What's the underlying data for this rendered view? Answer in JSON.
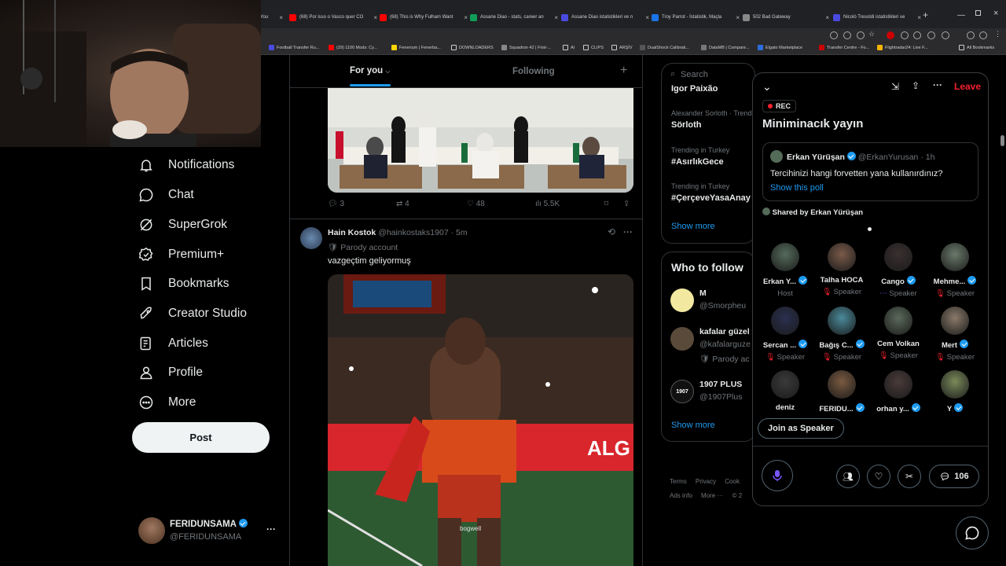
{
  "browser": {
    "tabs": [
      {
        "label": "You",
        "color": "#ff0000"
      },
      {
        "label": "(68) Por isso o Vasco quer CO",
        "color": "#ff0000"
      },
      {
        "label": "(68) This is Why Fulham Want",
        "color": "#ff0000"
      },
      {
        "label": "Assane Diao - stats, career an",
        "color": "#0f9d58"
      },
      {
        "label": "Assane Diao istatistikleri ve n",
        "color": "#4a4adf"
      },
      {
        "label": "Troy Parrot - İstatistik, Maçla",
        "color": "#1a73e8"
      },
      {
        "label": "502 Bad Gateway",
        "color": "#888888"
      },
      {
        "label": "Nicolò Tresoldi istatistikleri ve",
        "color": "#4a4adf"
      }
    ],
    "new_tab": "+",
    "bookmarks": [
      "Football Transfer Ru...",
      "(29) 1100 Mods: Cy...",
      "Fenerium | Fenerba...",
      "DOWNLOADERS",
      "Squadron 42 | First-...",
      "AI",
      "CLIPS",
      "ARŞİV",
      "DualShock Calibrati...",
      "DataMB | Compare...",
      "Elgato Marketplace",
      "Transfer Centre - Fo...",
      "Flightradar24: Live F...",
      "All Bookmarks"
    ]
  },
  "nav": {
    "items": [
      {
        "label": "Notifications",
        "icon": "bell-icon"
      },
      {
        "label": "Chat",
        "icon": "chat-icon"
      },
      {
        "label": "SuperGrok",
        "icon": "grok-icon"
      },
      {
        "label": "Premium+",
        "icon": "premium-icon"
      },
      {
        "label": "Bookmarks",
        "icon": "bookmark-icon"
      },
      {
        "label": "Creator Studio",
        "icon": "rocket-icon"
      },
      {
        "label": "Articles",
        "icon": "article-icon"
      },
      {
        "label": "Profile",
        "icon": "profile-icon"
      },
      {
        "label": "More",
        "icon": "more-icon"
      }
    ],
    "post_label": "Post",
    "account": {
      "name": "FERIDUNSAMA",
      "handle": "@FERIDUNSAMA",
      "more": "···"
    }
  },
  "timeline": {
    "tabs": [
      {
        "label": "For you"
      },
      {
        "label": "Following"
      }
    ],
    "add": "+",
    "tweet1": {
      "replies": "3",
      "retweets": "4",
      "likes": "48",
      "views": "5.5K"
    },
    "tweet2": {
      "name": "Hain Kostok",
      "handle": "@hainkostaks1907",
      "time": "· 5m",
      "badge": "Parody account",
      "text": "vazgeçtim geliyormuş",
      "watermark": "bogwell"
    }
  },
  "right": {
    "search_placeholder": "Search",
    "trends": [
      {
        "meta": "Alexander Sorloth · Trending",
        "title": "Sörloth"
      },
      {
        "meta": "Trending in Turkey",
        "title": "#AsırlıkGece"
      },
      {
        "meta": "Trending in Turkey",
        "title": "#ÇerçeveYasaAnay"
      }
    ],
    "top_trend_partial": "Igor Paixão",
    "show_more": "Show more",
    "who_to_follow": "Who to follow",
    "follow": [
      {
        "name": "M",
        "handle": "@Smorpheu",
        "extra": ""
      },
      {
        "name": "kafalar güzel",
        "handle": "@kafalarguze",
        "extra": "Parody ac"
      },
      {
        "name": "1907 PLUS",
        "handle": "@1907Plus",
        "extra": ""
      }
    ],
    "show_more2": "Show more",
    "footer": [
      "Terms",
      "Privacy",
      "Cook",
      "Ads info",
      "More ···",
      "© 2"
    ]
  },
  "space": {
    "leave": "Leave",
    "rec": "REC",
    "title": "Miniminacık yayın",
    "poll": {
      "author": "Erkan Yürüşan",
      "handle": "@ErkanYurusan",
      "time": "· 1h",
      "text": "Tercihinizi hangi forvetten yana kullanırdınız?",
      "link": "Show this poll"
    },
    "shared_by": "Shared by Erkan Yürüşan",
    "participants": [
      {
        "name": "Erkan Y...",
        "role": "Host",
        "verified": true,
        "color": "#556b5a"
      },
      {
        "name": "Talha HOCA",
        "role": "Speaker",
        "verified": false,
        "color": "#7a5a4a"
      },
      {
        "name": "Cango",
        "role": "Speaker",
        "verified": true,
        "color": "#3a3030"
      },
      {
        "name": "Mehme...",
        "role": "Speaker",
        "verified": true,
        "color": "#6a7a6a"
      },
      {
        "name": "Sercan ...",
        "role": "Speaker",
        "verified": true,
        "color": "#2a3050"
      },
      {
        "name": "Bağış C...",
        "role": "Speaker",
        "verified": true,
        "color": "#4a8a9a"
      },
      {
        "name": "Cem Volkan",
        "role": "Speaker",
        "verified": false,
        "color": "#5a6a5a"
      },
      {
        "name": "Mert",
        "role": "Speaker",
        "verified": true,
        "color": "#8a7a6a"
      },
      {
        "name": "deniz",
        "role": "",
        "verified": false,
        "color": "#3a3a3a"
      },
      {
        "name": "FERIDU...",
        "role": "",
        "verified": true,
        "color": "#7a5a40"
      },
      {
        "name": "orhan y...",
        "role": "",
        "verified": true,
        "color": "#4a3a3a"
      },
      {
        "name": "Y",
        "role": "",
        "verified": true,
        "color": "#7a8a5a"
      }
    ],
    "join_label": "Join as Speaker",
    "comments": "106",
    "accent": "#f4212e"
  }
}
